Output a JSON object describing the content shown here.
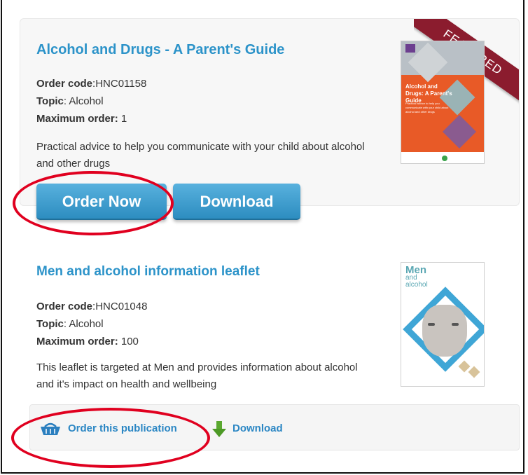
{
  "featured_item": {
    "title": "Alcohol and Drugs - A Parent's Guide",
    "order_code_label": "Order code",
    "order_code": ":HNC01158",
    "topic_label": "Topic",
    "topic": ": Alcohol",
    "max_order_label": "Maximum order:",
    "max_order": " 1",
    "description": "Practical advice to help you communicate with your child about alcohol and other drugs",
    "ribbon": "FEATURED",
    "cover": {
      "title": "Alcohol and Drugs: A Parent's Guide",
      "subtitle": "Practical advice to help you communicate with your child about alcohol and other drugs",
      "accent_color": "#e85a27"
    },
    "order_button": "Order Now",
    "download_button": "Download"
  },
  "second_item": {
    "title": "Men and alcohol information leaflet",
    "order_code_label": "Order code",
    "order_code": ":HNC01048",
    "topic_label": "Topic",
    "topic": ": Alcohol",
    "max_order_label": "Maximum order:",
    "max_order": " 100",
    "description": "This leaflet is targeted at Men and provides information about alcohol and it's impact on health and wellbeing",
    "cover": {
      "line1": "Men",
      "line2": "and",
      "line3": "alcohol"
    },
    "order_link": "Order this publication",
    "download_link": "Download"
  },
  "colors": {
    "link_blue": "#2c93c9",
    "button_blue": "#3a9bd0",
    "ribbon": "#8b1c2e",
    "highlight_circle": "#e0001f"
  }
}
